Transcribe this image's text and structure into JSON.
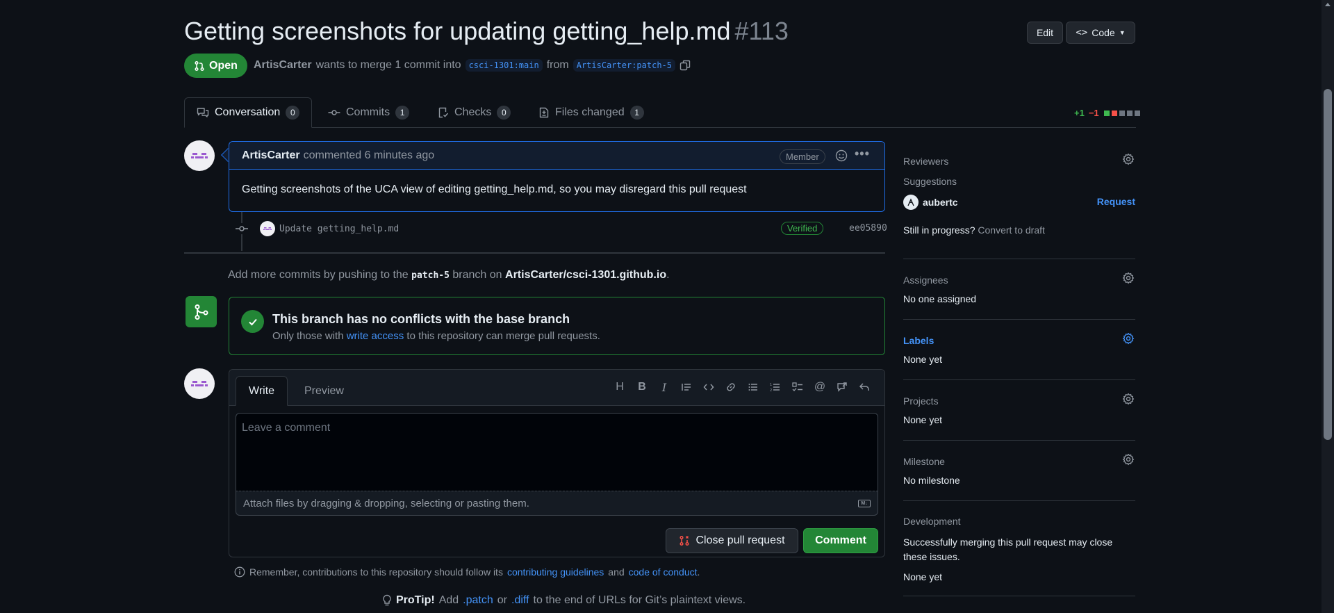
{
  "header": {
    "title": "Getting screenshots for updating getting_help.md",
    "pr_number": "#113",
    "edit_label": "Edit",
    "code_label": "Code",
    "state": "Open",
    "author": "ArtisCarter",
    "merge_text": "wants to merge 1 commit into",
    "base_branch": "csci-1301:main",
    "from_text": "from",
    "head_branch": "ArtisCarter:patch-5"
  },
  "tabs": [
    {
      "label": "Conversation",
      "count": "0"
    },
    {
      "label": "Commits",
      "count": "1"
    },
    {
      "label": "Checks",
      "count": "0"
    },
    {
      "label": "Files changed",
      "count": "1"
    }
  ],
  "diffstat": {
    "additions": "+1",
    "deletions": "−1"
  },
  "comment": {
    "author": "ArtisCarter",
    "action": "commented 6 minutes ago",
    "role": "Member",
    "body": "Getting screenshots of the UCA view of editing getting_help.md, so you may disregard this pull request"
  },
  "commit": {
    "message": "Update getting_help.md",
    "verified": "Verified",
    "sha": "ee05890"
  },
  "push_info": {
    "prefix": "Add more commits by pushing to the",
    "branch": "patch-5",
    "middle": "branch on",
    "repo": "ArtisCarter/csci-1301.github.io",
    "suffix": "."
  },
  "merge": {
    "title": "This branch has no conflicts with the base branch",
    "sub_prefix": "Only those with",
    "sub_link": "write access",
    "sub_suffix": "to this repository can merge pull requests."
  },
  "editor": {
    "write_tab": "Write",
    "preview_tab": "Preview",
    "placeholder": "Leave a comment",
    "attach_text": "Attach files by dragging & dropping, selecting or pasting them.",
    "close_label": "Close pull request",
    "comment_label": "Comment"
  },
  "footer": {
    "remember_prefix": "Remember, contributions to this repository should follow its",
    "guidelines": "contributing guidelines",
    "and": "and",
    "coc": "code of conduct",
    "period": ".",
    "protip_label": "ProTip!",
    "protip_add": "Add",
    "patch": ".patch",
    "or": "or",
    "diff": ".diff",
    "protip_suffix": "to the end of URLs for Git’s plaintext views."
  },
  "sidebar": {
    "reviewers": {
      "title": "Reviewers",
      "suggestions": "Suggestions",
      "suggested_user": "aubertc",
      "request": "Request",
      "in_progress": "Still in progress?",
      "convert": "Convert to draft"
    },
    "assignees": {
      "title": "Assignees",
      "value": "No one assigned"
    },
    "labels": {
      "title": "Labels",
      "value": "None yet"
    },
    "projects": {
      "title": "Projects",
      "value": "None yet"
    },
    "milestone": {
      "title": "Milestone",
      "value": "No milestone"
    },
    "development": {
      "title": "Development",
      "desc": "Successfully merging this pull request may close these issues.",
      "value": "None yet"
    }
  },
  "colors": {
    "background": "#0d1117",
    "accent_green": "#238636",
    "link_blue": "#4493f8",
    "border": "#30363d"
  }
}
